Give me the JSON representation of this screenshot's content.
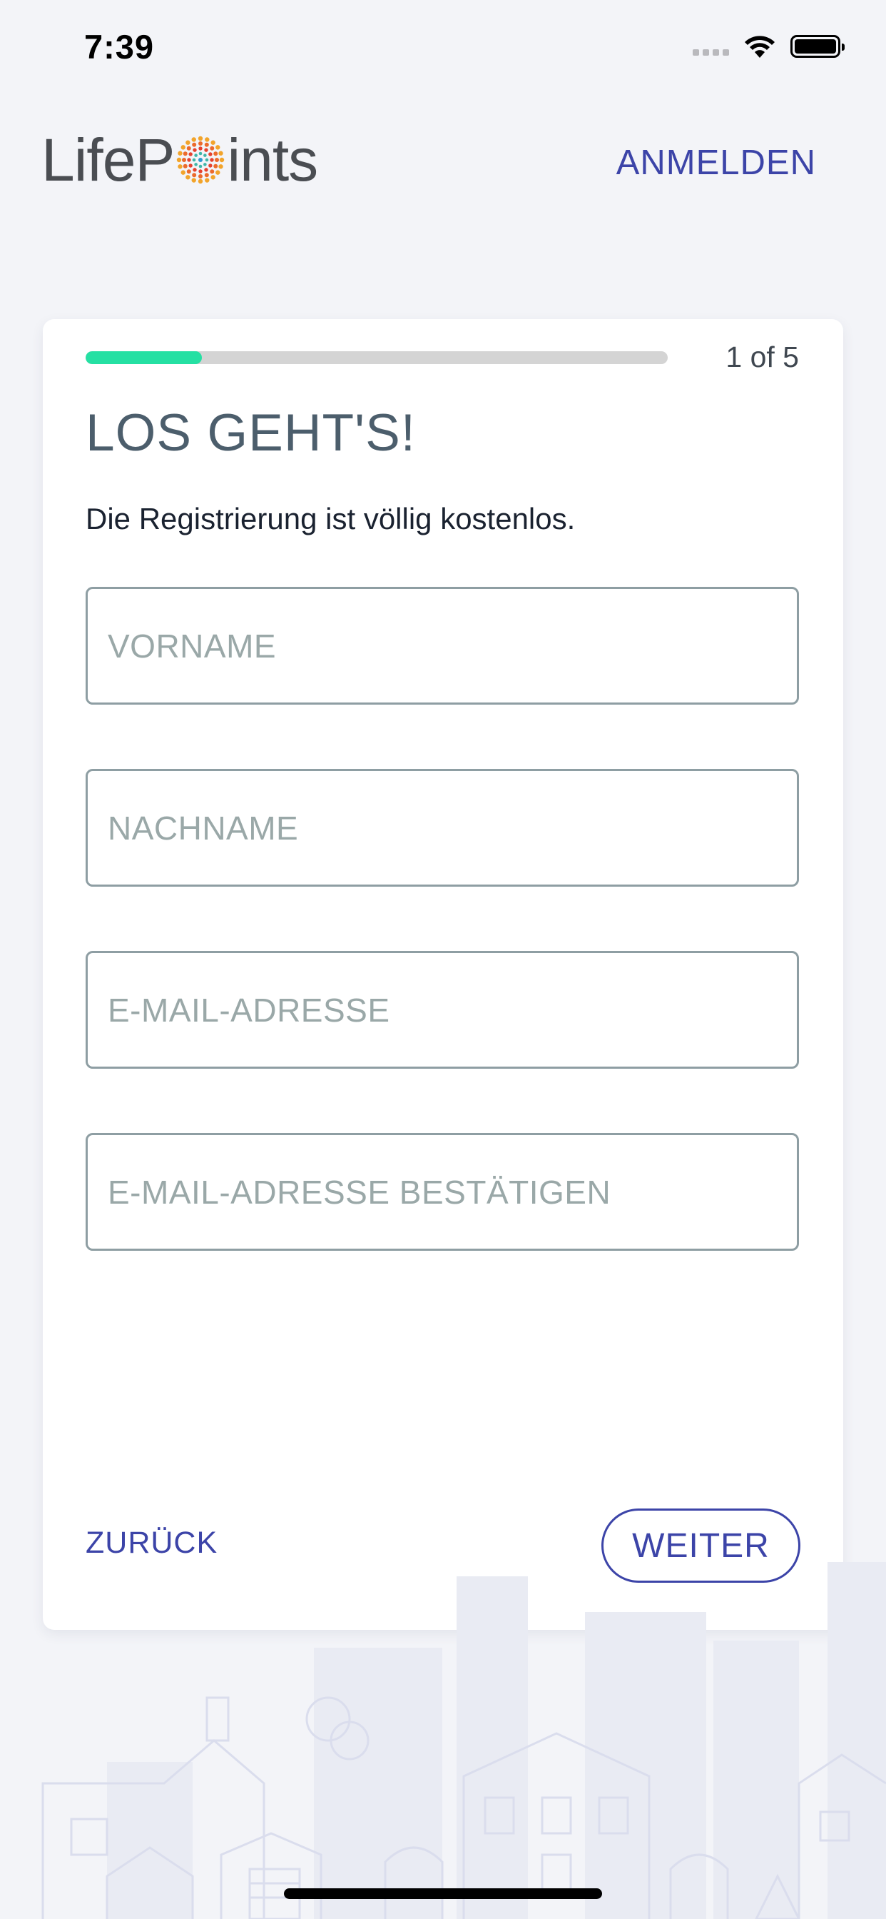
{
  "status_bar": {
    "time": "7:39"
  },
  "header": {
    "logo_text_left": "LifeP",
    "logo_text_right": "ints",
    "signin_label": "ANMELDEN"
  },
  "signup": {
    "step_text": "1 of 5",
    "progress": 0.2,
    "title": "LOS GEHT'S!",
    "subtitle": "Die Registrierung ist völlig kostenlos.",
    "fields": {
      "first_name": {
        "placeholder": "VORNAME",
        "value": ""
      },
      "last_name": {
        "placeholder": "NACHNAME",
        "value": ""
      },
      "email": {
        "placeholder": "E-MAIL-ADRESSE",
        "value": ""
      },
      "email_confirm": {
        "placeholder": "E-MAIL-ADRESSE BESTÄTIGEN",
        "value": ""
      }
    },
    "back_label": "ZURÜCK",
    "next_label": "WEITER"
  },
  "colors": {
    "accent": "#3c44a8",
    "progress": "#25e0a3",
    "background": "#f3f4f8"
  },
  "icons": [
    "wifi-icon",
    "battery-icon",
    "cellular-signal-icon",
    "lifepoints-logo-mark"
  ]
}
